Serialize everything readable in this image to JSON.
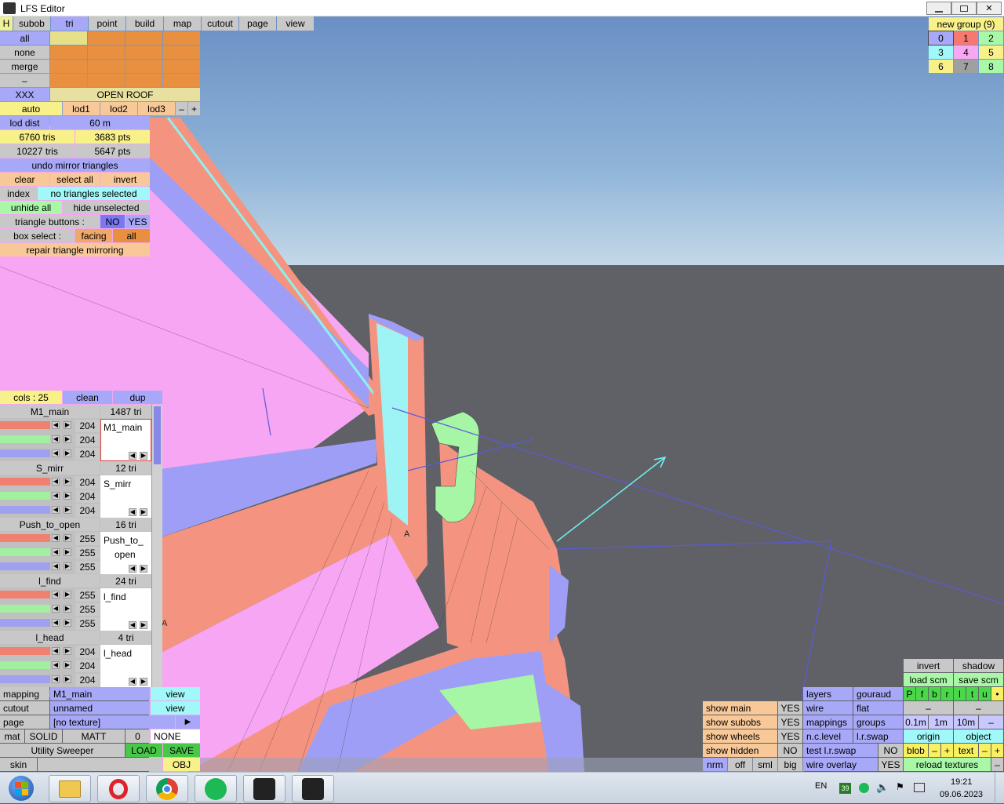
{
  "window": {
    "title": "LFS Editor",
    "controls": [
      "minimize",
      "restore",
      "close"
    ]
  },
  "top_tabs": [
    "H",
    "subob",
    "tri",
    "point",
    "build",
    "map",
    "cutout",
    "page",
    "view"
  ],
  "selection": {
    "all": "all",
    "none": "none",
    "merge": "merge",
    "dash": "–",
    "xxx": "XXX",
    "object_name": "OPEN ROOF"
  },
  "lod": {
    "auto": "auto",
    "lod1": "lod1",
    "lod2": "lod2",
    "lod3": "lod3",
    "minus": "–",
    "plus": "+",
    "dist_label": "lod dist",
    "dist_value": "60 m"
  },
  "counts": {
    "tris1": "6760 tris",
    "pts1": "3683 pts",
    "tris2": "10227 tris",
    "pts2": "5647 pts"
  },
  "tri_panel": {
    "undo": "undo mirror triangles",
    "clear": "clear",
    "select_all": "select all",
    "invert": "invert",
    "index": "index",
    "index_status": "no triangles selected",
    "unhide_all": "unhide all",
    "hide_unselected": "hide unselected",
    "tri_buttons_label": "triangle buttons :",
    "no": "NO",
    "yes": "YES",
    "box_select_label": "box select :",
    "facing": "facing",
    "all": "all",
    "repair": "repair triangle mirroring"
  },
  "cols": {
    "label": "cols : 25",
    "clean": "clean",
    "dup": "dup"
  },
  "materials": [
    {
      "name": "M1_main",
      "tris": "1487 tri",
      "values": [
        "204",
        "204",
        "204"
      ],
      "preview": "M1_main",
      "preview2": ""
    },
    {
      "name": "S_mirr",
      "tris": "12 tri",
      "values": [
        "204",
        "204",
        "204"
      ],
      "preview": "S_mirr",
      "preview2": ""
    },
    {
      "name": "Push_to_open",
      "tris": "16 tri",
      "values": [
        "255",
        "255",
        "255"
      ],
      "preview": "Push_to_",
      "preview2": "open"
    },
    {
      "name": "l_find",
      "tris": "24 tri",
      "values": [
        "255",
        "255",
        "255"
      ],
      "preview": "l_find",
      "preview2": ""
    },
    {
      "name": "l_head",
      "tris": "4 tri",
      "values": [
        "204",
        "204",
        "204"
      ],
      "preview": "l_head",
      "preview2": ""
    }
  ],
  "bottom_left": {
    "mapping_label": "mapping",
    "mapping_value": "M1_main",
    "mapping_view": "view",
    "cutout_label": "cutout",
    "cutout_value": "unnamed",
    "cutout_view": "view",
    "page_label": "page",
    "page_value": "[no texture]",
    "page_arrow": "▶",
    "mat_label": "mat",
    "mat_solid": "SOLID",
    "mat_matt": "MATT",
    "mat_zero": "0",
    "mat_none": "NONE",
    "utility": "Utility Sweeper",
    "load": "LOAD",
    "save": "SAVE",
    "skin": "skin",
    "obj": "OBJ"
  },
  "groups": {
    "title": "new group (9)",
    "numbers": [
      "0",
      "1",
      "2",
      "3",
      "4",
      "5",
      "6",
      "7",
      "8"
    ]
  },
  "bottom_right": {
    "invert": "invert",
    "shadow": "shadow",
    "load_scm": "load scm",
    "save_scm": "save scm",
    "letters": [
      "P",
      "f",
      "b",
      "r",
      "l",
      "t",
      "u",
      "•"
    ],
    "dash1": "–",
    "dash2": "–",
    "show_main": "show main",
    "show_main_val": "YES",
    "show_subobs": "show subobs",
    "show_subobs_val": "YES",
    "show_wheels": "show wheels",
    "show_wheels_val": "YES",
    "show_hidden": "show hidden",
    "show_hidden_val": "NO",
    "nrm": "nrm",
    "off": "off",
    "sml": "sml",
    "big": "big",
    "layers": "layers",
    "gouraud": "gouraud",
    "wire": "wire",
    "flat": "flat",
    "mappings": "mappings",
    "groups": "groups",
    "nc_level": "n.c.level",
    "lr_swap": "l.r.swap",
    "test_lr_swap": "test l.r.swap",
    "test_val": "NO",
    "wire_overlay": "wire overlay",
    "wire_overlay_val": "YES",
    "d01": "0.1m",
    "d1": "1m",
    "d10": "10m",
    "dminus": "–",
    "origin": "origin",
    "object": "object",
    "blob": "blob",
    "blob_minus": "–",
    "blob_plus": "+",
    "text": "text",
    "text_minus": "–",
    "text_plus": "+",
    "reload": "reload textures",
    "reload_minus": "–"
  },
  "taskbar": {
    "lang": "EN",
    "badge": "39",
    "time": "19:21",
    "date": "09.06.2023"
  },
  "viewport_marks": [
    "A",
    "A"
  ]
}
